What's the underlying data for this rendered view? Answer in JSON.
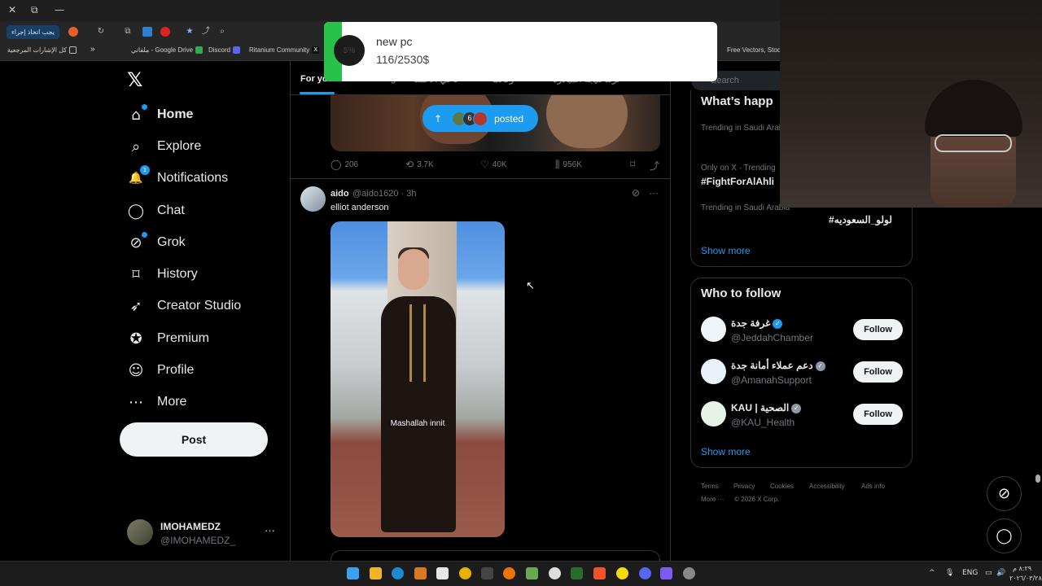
{
  "browser": {
    "window_controls": [
      "✕",
      "⧉",
      "—"
    ],
    "tab_pill_label": "يجب اتخاذ إجراء",
    "bookmarks_overflow": "»",
    "bookmarks_all": "كل الإشارات المرجعية",
    "bookmarks": [
      "ملفاتي - Google Drive",
      "Discord",
      "Ritanium Community",
      "Free Vectors, Stock..."
    ],
    "bookmark_x_glyph": "X"
  },
  "sidebar": {
    "logo": "𝕏",
    "items": [
      {
        "label": "Home",
        "icon": "⌂"
      },
      {
        "label": "Explore",
        "icon": "⌕"
      },
      {
        "label": "Notifications",
        "icon": "🔔",
        "badge": "1"
      },
      {
        "label": "Chat",
        "icon": "◯"
      },
      {
        "label": "Grok",
        "icon": "⊘"
      },
      {
        "label": "History",
        "icon": "⌑"
      },
      {
        "label": "Creator Studio",
        "icon": "➶"
      },
      {
        "label": "Premium",
        "icon": "✪"
      },
      {
        "label": "Profile",
        "icon": "☺"
      },
      {
        "label": "More",
        "icon": "⋯"
      }
    ],
    "post_button": "Post",
    "account": {
      "name": "IMOHAMEDZ",
      "handle": "@IMOHAMEDZ_",
      "more": "···"
    }
  },
  "feed": {
    "tabs": [
      "For you",
      "Following",
      "تاخي الأحمد",
      "زكاتك",
      "ترند نتيجة المبادرة"
    ],
    "posted_pill": {
      "arrow": "↑",
      "count": "6",
      "label": "posted"
    },
    "actions": {
      "replies": "206",
      "reposts": "3.7K",
      "likes": "40K",
      "views": "956K"
    },
    "tweet": {
      "name": "aido",
      "handle": "@aido1620",
      "time": "3h",
      "meta": "@aido1620 · 3h",
      "text": "elliot anderson",
      "caption": "Mashallah innit",
      "more": "···"
    }
  },
  "right": {
    "search_placeholder": "Search",
    "trends_title": "What’s happ",
    "trends": [
      {
        "context": "Trending in Saudi Arab",
        "name": ""
      },
      {
        "context": "Only on X · Trending",
        "name": "#FightForAlAhli"
      },
      {
        "context": "Trending in Saudi Arabia",
        "name": "#لولو_السعوديه",
        "more": "···"
      }
    ],
    "trends_show_more": "Show more",
    "who_to_follow_title": "Who to follow",
    "follow_suggestions": [
      {
        "name": "غرفة جدة",
        "handle": "@JeddahChamber",
        "button": "Follow",
        "verified_color": "#1d9bf0"
      },
      {
        "name": "دعم عملاء أمانة جدة",
        "handle": "@AmanahSupport",
        "button": "Follow",
        "verified_color": "#8b98a5"
      },
      {
        "name": "KAU | الصحية",
        "handle": "@KAU_Health",
        "button": "Follow",
        "verified_color": "#8b98a5"
      }
    ],
    "wtf_show_more": "Show more",
    "footer": [
      "Terms",
      "Privacy",
      "Cookies",
      "Accessibility",
      "Ads info",
      "More ···",
      "© 2026 X Corp."
    ]
  },
  "donation": {
    "title": "new pc",
    "amount": "116/2530$",
    "percent_label": "5%",
    "progress_fraction": 0.046,
    "bar_color": "#27c24a"
  },
  "taskbar": {
    "tray_up": "^",
    "lang": "ENG",
    "time": "٨:٢٩ م",
    "date": "٢٠٢٦/٠٣/٢٨"
  },
  "accent_color": "#1d9bf0"
}
